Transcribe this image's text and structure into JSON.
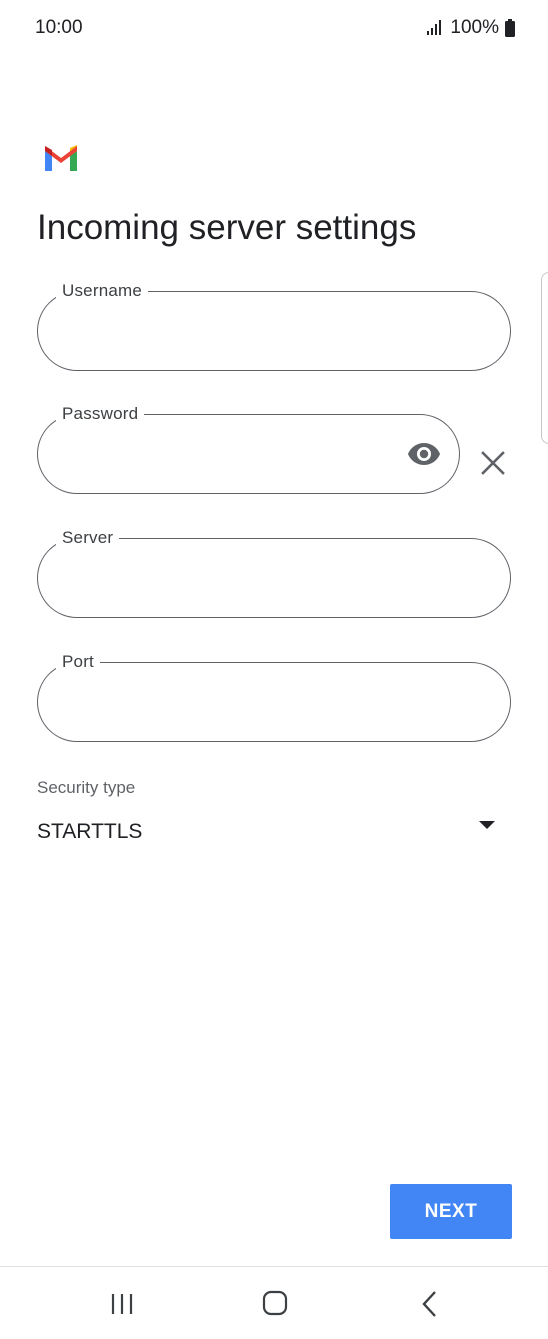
{
  "status_bar": {
    "time": "10:00",
    "battery": "100%"
  },
  "app": {
    "logo_icon": "gmail-logo",
    "title": "Incoming server settings"
  },
  "form": {
    "username": {
      "label": "Username",
      "value": ""
    },
    "password": {
      "label": "Password",
      "value": ""
    },
    "server": {
      "label": "Server",
      "value": ""
    },
    "port": {
      "label": "Port",
      "value": ""
    },
    "security": {
      "label": "Security type",
      "value": "STARTTLS"
    }
  },
  "actions": {
    "next_label": "NEXT"
  },
  "colors": {
    "accent": "#4285f4",
    "outline": "#5f6368",
    "text": "#202124"
  },
  "icons": {
    "eye": "visibility-icon",
    "clear": "close-icon",
    "dropdown": "arrow-drop-down-icon",
    "nav_recents": "recents-icon",
    "nav_home": "home-icon",
    "nav_back": "back-icon"
  }
}
